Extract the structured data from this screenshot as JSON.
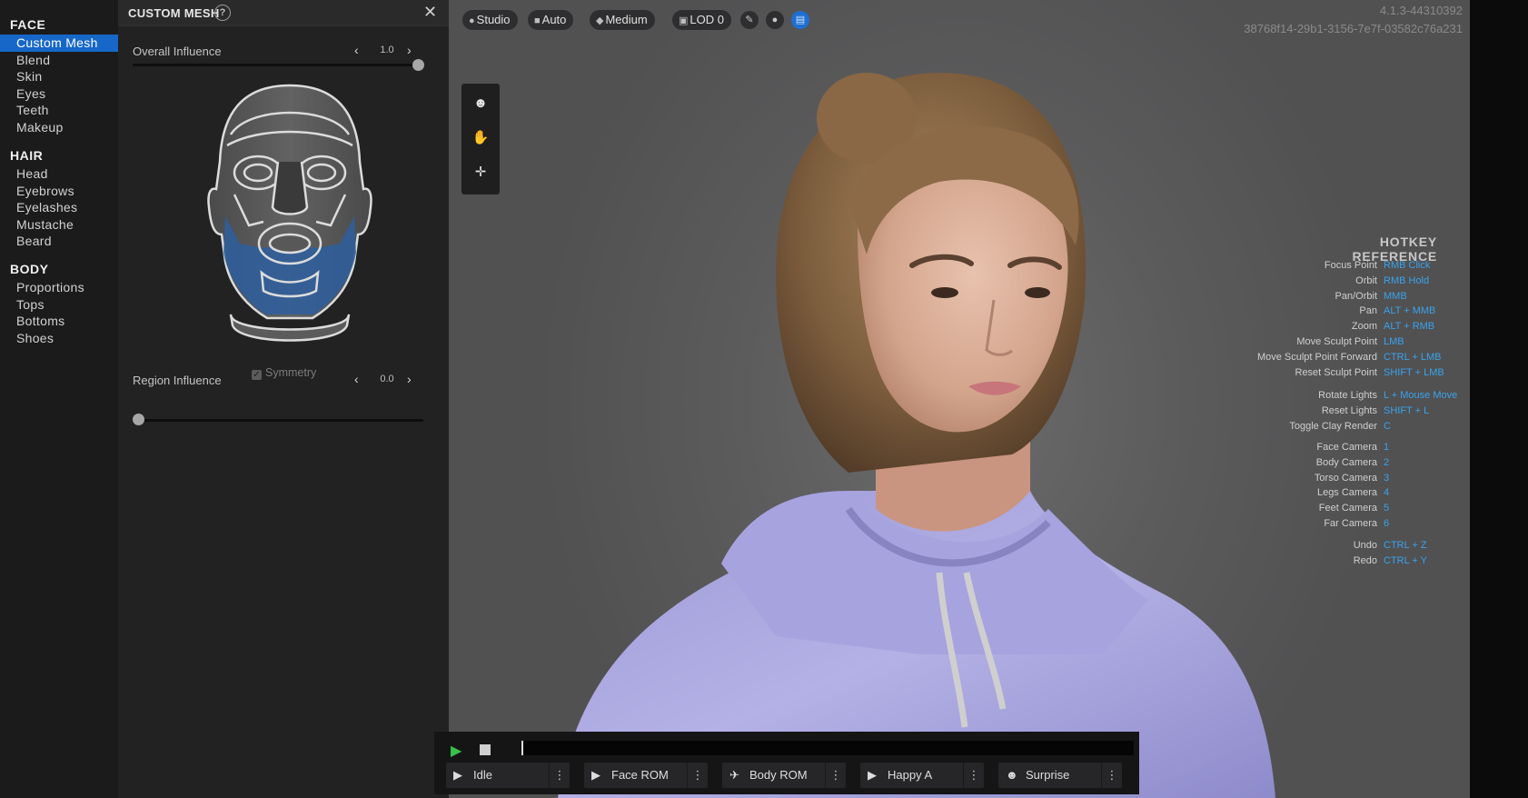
{
  "nav": {
    "sections": [
      {
        "title": "FACE",
        "items": [
          "Custom Mesh",
          "Blend",
          "Skin",
          "Eyes",
          "Teeth",
          "Makeup"
        ]
      },
      {
        "title": "HAIR",
        "items": [
          "Head",
          "Eyebrows",
          "Eyelashes",
          "Mustache",
          "Beard"
        ]
      },
      {
        "title": "BODY",
        "items": [
          "Proportions",
          "Tops",
          "Bottoms",
          "Shoes"
        ]
      }
    ],
    "active_item": "Custom Mesh"
  },
  "panel": {
    "title": "CUSTOM MESH",
    "help_icon": "?",
    "close_icon": "✕",
    "overall_influence": {
      "label": "Overall Influence",
      "value": "1.0",
      "level": 1.0
    },
    "symmetry": {
      "label": "Symmetry",
      "checked": true
    },
    "region_influence": {
      "label": "Region Influence",
      "value": "0.0",
      "level": 0.0
    }
  },
  "toolbar": {
    "studio": "Studio",
    "auto": "Auto",
    "medium": "Medium",
    "lod": "LOD 0"
  },
  "build": {
    "version": "4.1.3-44310392",
    "guid": "38768f14-29b1-3156-7e7f-03582c76a231"
  },
  "hotkeys": {
    "title": "HOTKEY REFERENCE",
    "groups": [
      [
        {
          "action": "Focus Point",
          "key": "RMB Click"
        },
        {
          "action": "Orbit",
          "key": "RMB Hold"
        },
        {
          "action": "Pan/Orbit",
          "key": "MMB"
        },
        {
          "action": "Pan",
          "key": "ALT + MMB"
        },
        {
          "action": "Zoom",
          "key": "ALT + RMB"
        },
        {
          "action": "Move Sculpt Point",
          "key": "LMB"
        },
        {
          "action": "Move Sculpt Point Forward",
          "key": "CTRL + LMB"
        },
        {
          "action": "Reset Sculpt Point",
          "key": "SHIFT + LMB"
        }
      ],
      [
        {
          "action": "Rotate Lights",
          "key": "L + Mouse Move"
        },
        {
          "action": "Reset Lights",
          "key": "SHIFT + L"
        },
        {
          "action": "Toggle Clay Render",
          "key": "C"
        }
      ],
      [
        {
          "action": "Face Camera",
          "key": "1"
        },
        {
          "action": "Body Camera",
          "key": "2"
        },
        {
          "action": "Torso Camera",
          "key": "3"
        },
        {
          "action": "Legs Camera",
          "key": "4"
        },
        {
          "action": "Feet Camera",
          "key": "5"
        },
        {
          "action": "Far Camera",
          "key": "6"
        }
      ],
      [
        {
          "action": "Undo",
          "key": "CTRL + Z"
        },
        {
          "action": "Redo",
          "key": "CTRL + Y"
        }
      ]
    ]
  },
  "animations": [
    {
      "label": "Idle",
      "icon": "play-circle-icon"
    },
    {
      "label": "Face ROM",
      "icon": "play-circle-icon"
    },
    {
      "label": "Body ROM",
      "icon": "running-figure-icon"
    },
    {
      "label": "Happy A",
      "icon": "play-circle-icon"
    },
    {
      "label": "Surprise",
      "icon": "face-icon"
    }
  ],
  "colors": {
    "accent": "#1667c8",
    "hotkey": "#3aa2ea",
    "play": "#38c24a",
    "hoodie": "#a9a6df"
  }
}
